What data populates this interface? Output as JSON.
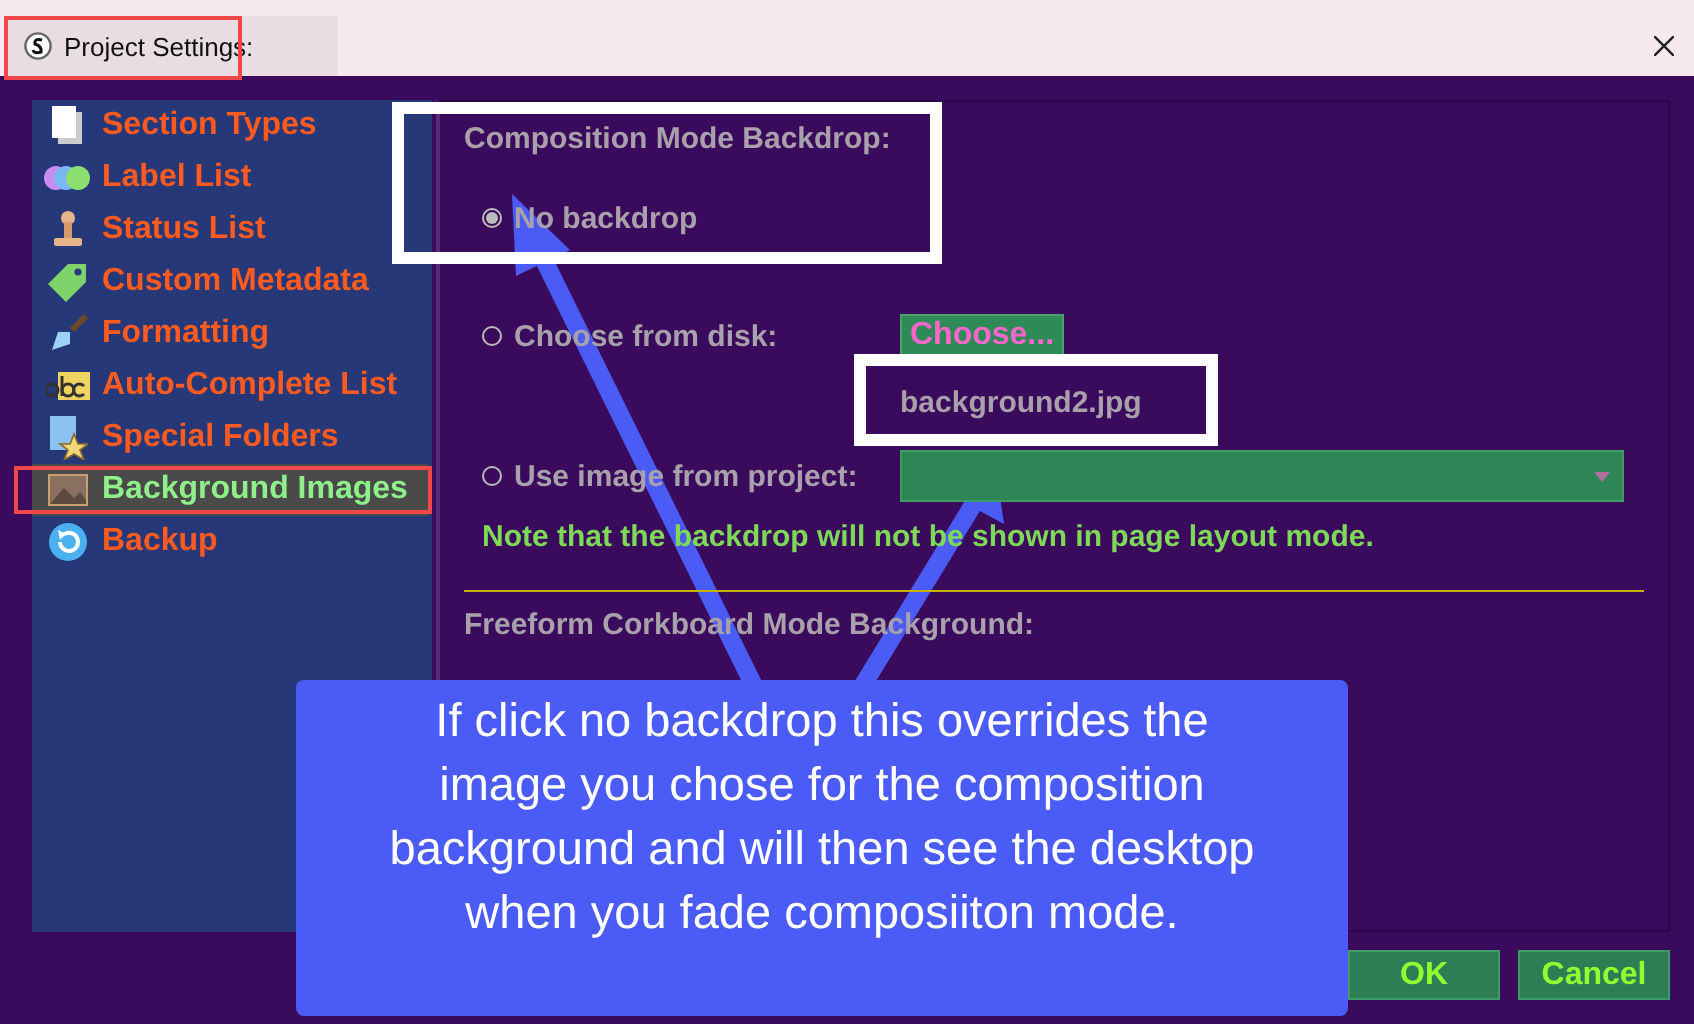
{
  "window": {
    "title": "Project Settings:"
  },
  "sidebar": {
    "items": [
      {
        "label": "Section Types",
        "selected": false
      },
      {
        "label": "Label List",
        "selected": false
      },
      {
        "label": "Status List",
        "selected": false
      },
      {
        "label": "Custom Metadata",
        "selected": false
      },
      {
        "label": "Formatting",
        "selected": false
      },
      {
        "label": "Auto-Complete List",
        "selected": false
      },
      {
        "label": "Special Folders",
        "selected": false
      },
      {
        "label": "Background Images",
        "selected": true
      },
      {
        "label": "Backup",
        "selected": false
      }
    ]
  },
  "composition": {
    "title": "Composition Mode Backdrop:",
    "options": [
      {
        "label": "No backdrop",
        "selected": true
      },
      {
        "label": "Choose from disk:",
        "selected": false
      },
      {
        "label": "Use image from project:",
        "selected": false
      }
    ],
    "choose_button": "Choose...",
    "file_name": "background2.jpg",
    "note": "Note that the backdrop will not be shown in page layout mode."
  },
  "freeform": {
    "title": "Freeform Corkboard Mode Background:"
  },
  "buttons": [
    "OK",
    "Cancel"
  ],
  "annotation": {
    "callout": "If click no backdrop this overrides the image you chose for the composition background and will then see the desktop when you fade composiiton mode."
  }
}
